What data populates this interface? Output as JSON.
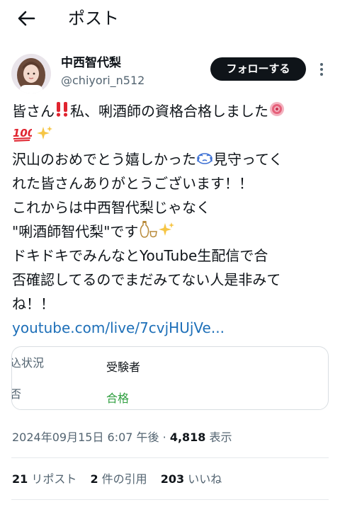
{
  "header": {
    "title": "ポスト",
    "back_icon": "arrow-left-icon"
  },
  "author": {
    "display_name": "中西智代梨",
    "handle": "@chiyori_n512",
    "follow_label": "フォローする",
    "more_icon": "more-vertical-icon"
  },
  "tweet": {
    "lines": [
      "皆さん",
      "私、唎酒師の資格合格しました",
      "沢山のおめでとう嬉しかった",
      "見守ってく",
      "れた皆さんありがとうございます！！",
      "これからは中西智代梨じゃなく",
      "\"唎酒師智代梨\"です",
      "ドキドキでみんなとYouTube生配信で合",
      "否確認してるのでまだみてない人是非みて",
      "ね！！"
    ],
    "emojis": [
      "double-exclamation",
      "rosette",
      "hundred-points",
      "sparkles",
      "crying-face",
      "sake-bottle",
      "sparkles"
    ],
    "link": "youtube.com/live/7cvjHUjVe..."
  },
  "card": {
    "row1_label": "込状況",
    "row1_value": "受験者",
    "row2_label": "否",
    "row2_value": "合格",
    "accent_pass": "#2e9e3f"
  },
  "meta": {
    "datetime": "2024年09月15日 6:07 午後 · ",
    "views_count": "4,818",
    "views_label": " 表示"
  },
  "stats": {
    "reposts_count": "21",
    "reposts_label": " リポスト",
    "quotes_count": "2",
    "quotes_label": " 件の引用",
    "likes_count": "203",
    "likes_label": " いいね"
  },
  "colors": {
    "link": "#1d6fb8",
    "muted": "#536471",
    "text": "#0f1419"
  }
}
